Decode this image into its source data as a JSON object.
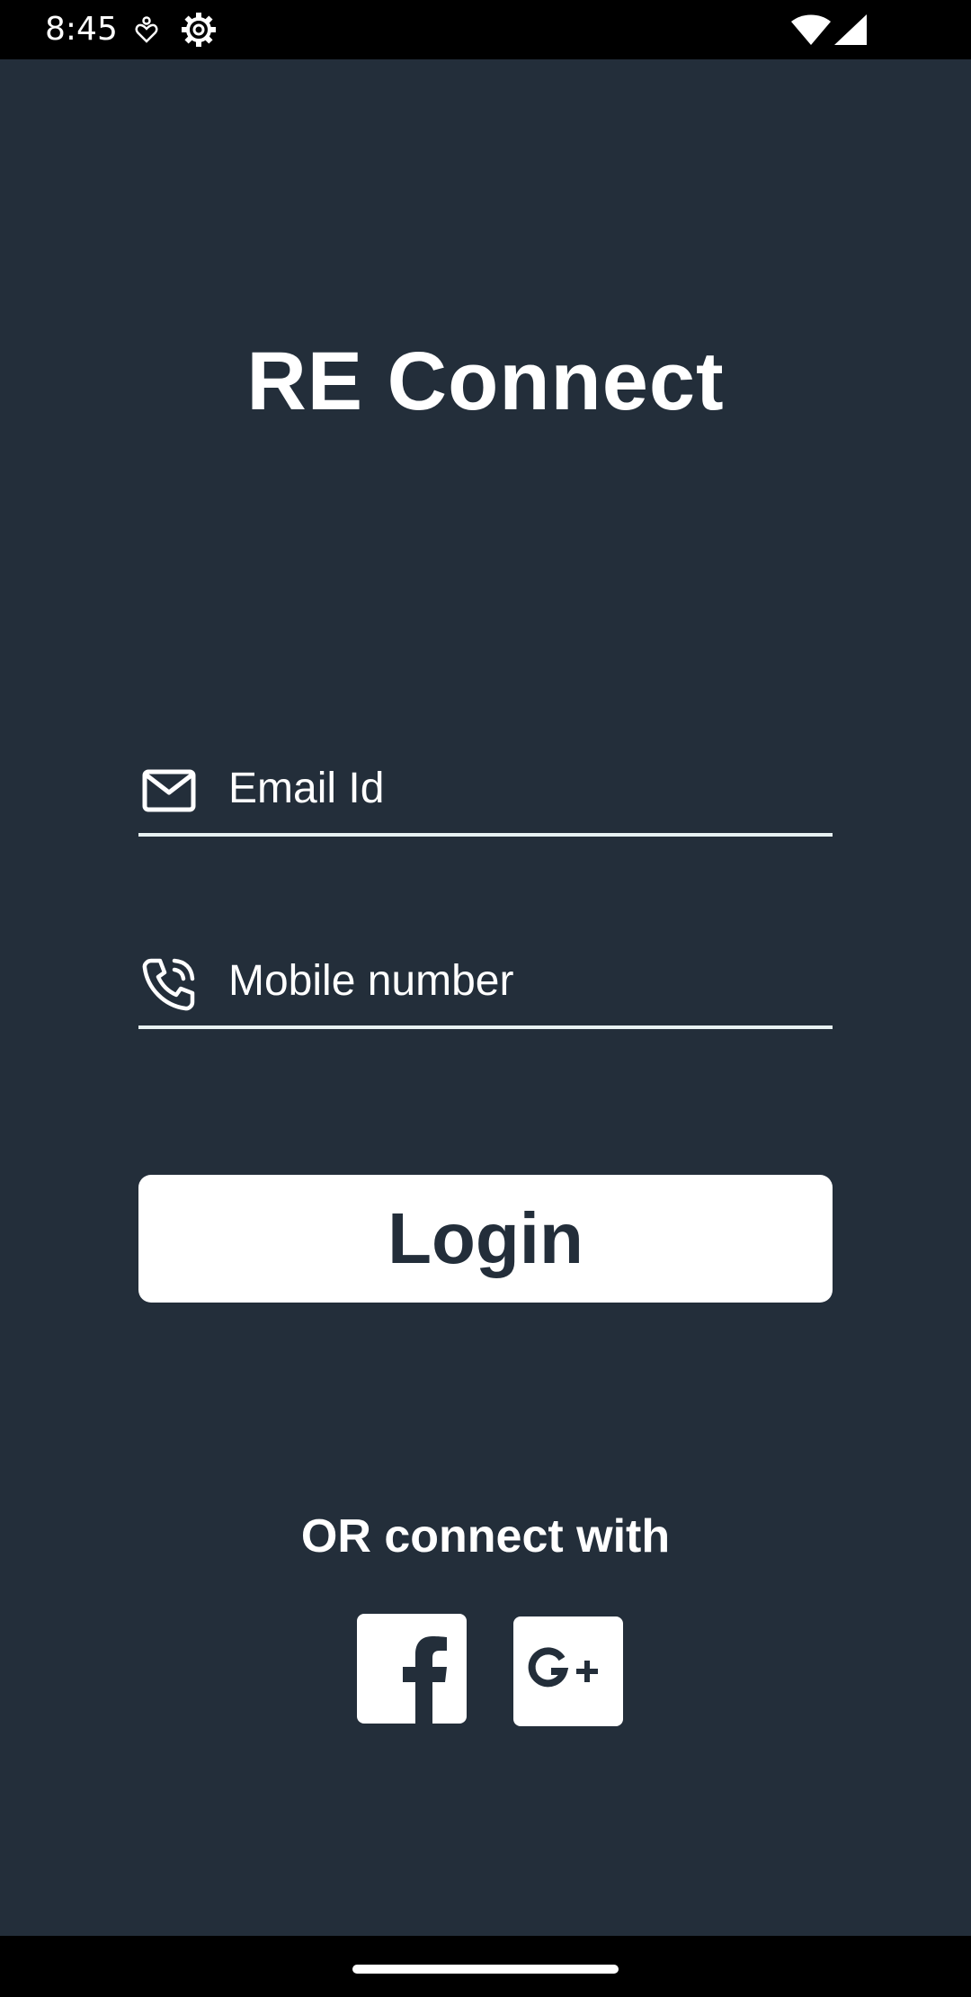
{
  "status_bar": {
    "time": "8:45",
    "icons": [
      "notification-heart-icon",
      "settings-gear-icon",
      "wifi-icon",
      "cell-signal-icon"
    ]
  },
  "app": {
    "title": "RE Connect",
    "email_field": {
      "placeholder": "Email Id",
      "value": "",
      "icon": "mail-icon"
    },
    "mobile_field": {
      "placeholder": "Mobile number",
      "value": "",
      "icon": "phone-icon"
    },
    "login_label": "Login",
    "or_text": "OR connect with",
    "social": [
      {
        "name": "facebook",
        "icon": "facebook-icon"
      },
      {
        "name": "google-plus",
        "icon": "google-plus-icon"
      }
    ]
  },
  "colors": {
    "background": "#232e3a",
    "text": "#ffffff",
    "underline": "#e8f2f2",
    "button_bg": "#ffffff",
    "button_text": "#232e3a",
    "system_bars": "#000000"
  }
}
